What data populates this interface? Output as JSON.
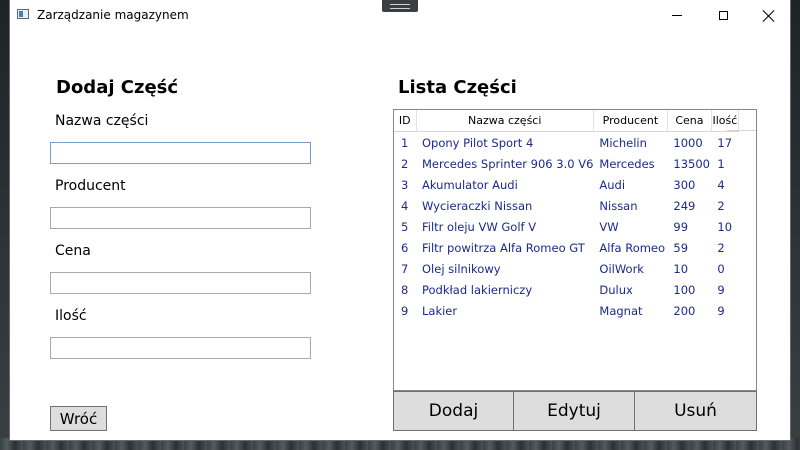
{
  "window": {
    "title": "Zarządzanie magazynem"
  },
  "form": {
    "heading": "Dodaj Część",
    "name_label": "Nazwa części",
    "producer_label": "Producent",
    "price_label": "Cena",
    "qty_label": "Ilość",
    "name_value": "",
    "producer_value": "",
    "price_value": "",
    "qty_value": "",
    "back_label": "Wróć"
  },
  "list": {
    "heading": "Lista Części",
    "columns": {
      "id": "ID",
      "name": "Nazwa części",
      "producer": "Producent",
      "price": "Cena",
      "qty": "Ilość"
    },
    "rows": [
      {
        "id": "1",
        "name": "Opony Pilot Sport 4",
        "producer": "Michelin",
        "price": "1000",
        "qty": "17"
      },
      {
        "id": "2",
        "name": "Mercedes Sprinter 906 3.0 V6",
        "producer": "Mercedes",
        "price": "13500",
        "qty": "1"
      },
      {
        "id": "3",
        "name": "Akumulator Audi",
        "producer": "Audi",
        "price": "300",
        "qty": "4"
      },
      {
        "id": "4",
        "name": "Wycieraczki Nissan",
        "producer": "Nissan",
        "price": "249",
        "qty": "2"
      },
      {
        "id": "5",
        "name": "Filtr oleju VW Golf V",
        "producer": "VW",
        "price": "99",
        "qty": "10"
      },
      {
        "id": "6",
        "name": "Filtr powitrza Alfa Romeo GT",
        "producer": "Alfa Romeo",
        "price": "59",
        "qty": "2"
      },
      {
        "id": "7",
        "name": "Olej silnikowy",
        "producer": "OilWork",
        "price": "10",
        "qty": "0"
      },
      {
        "id": "8",
        "name": "Podkład lakierniczy",
        "producer": "Dulux",
        "price": "100",
        "qty": "9"
      },
      {
        "id": "9",
        "name": "Lakier",
        "producer": "Magnat",
        "price": "200",
        "qty": "9"
      }
    ]
  },
  "actions": {
    "add_label": "Dodaj",
    "edit_label": "Edytuj",
    "delete_label": "Usuń"
  },
  "colors": {
    "row_text": "#1b2a8a",
    "button_bg": "#dddddd",
    "input_focus_border": "#7a9cc9"
  },
  "icons": {
    "app": "app-window-icon",
    "minimize": "minimize-icon",
    "maximize": "maximize-icon",
    "close": "close-icon"
  }
}
